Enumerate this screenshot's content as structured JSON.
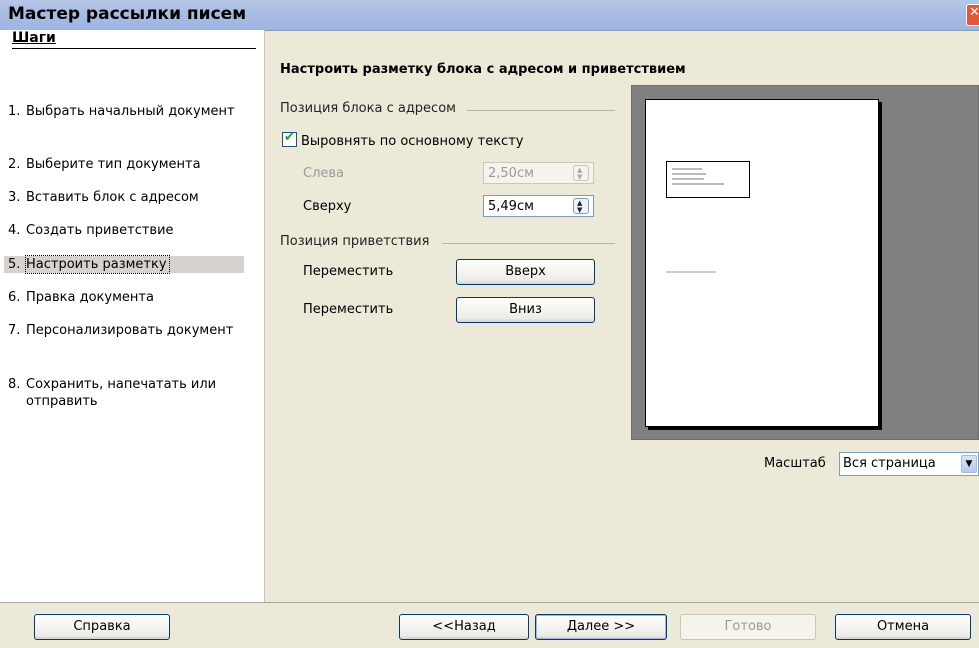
{
  "window": {
    "title": "Мастер рассылки писем"
  },
  "steps": {
    "title": "Шаги",
    "items": [
      {
        "num": "1.",
        "label": "Выбрать начальный документ"
      },
      {
        "num": "2.",
        "label": "Выберите тип документа"
      },
      {
        "num": "3.",
        "label": "Вставить блок с адресом"
      },
      {
        "num": "4.",
        "label": "Создать приветствие"
      },
      {
        "num": "5.",
        "label": "Настроить разметку"
      },
      {
        "num": "6.",
        "label": "Правка документа"
      },
      {
        "num": "7.",
        "label": "Персонализировать документ"
      },
      {
        "num": "8.",
        "label": "Сохранить, напечатать или отправить"
      }
    ],
    "selected_index": 4
  },
  "main": {
    "heading": "Настроить разметку блока с адресом и приветствием",
    "address_group": {
      "title": "Позиция блока с адресом",
      "align_checkbox": {
        "label": "Выровнять по основному тексту",
        "checked": true
      },
      "left": {
        "label": "Слева",
        "value": "2,50см",
        "enabled": false
      },
      "top": {
        "label": "Сверху",
        "value": "5,49см",
        "enabled": true
      }
    },
    "greeting_group": {
      "title": "Позиция приветствия",
      "move_up": {
        "label": "Переместить",
        "button": "Вверх"
      },
      "move_down": {
        "label": "Переместить",
        "button": "Вниз"
      }
    },
    "zoom": {
      "label": "Масштаб",
      "value": "Вся страница"
    }
  },
  "buttons": {
    "help": "Справка",
    "back": "<<Назад",
    "next": "Далее >>",
    "finish": "Готово",
    "cancel": "Отмена"
  }
}
